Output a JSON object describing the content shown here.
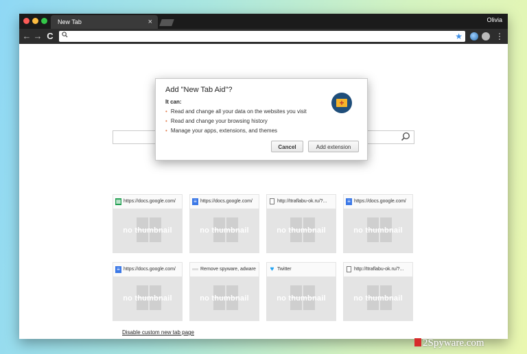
{
  "browser": {
    "tab_title": "New Tab",
    "tab_close": "×",
    "profile_name": "Olivia",
    "url": ""
  },
  "dialog": {
    "title": "Add \"New Tab Aid\"?",
    "it_can": "It can:",
    "permissions": [
      "Read and change all your data on the websites you visit",
      "Read and change your browsing history",
      "Manage your apps, extensions, and themes"
    ],
    "cancel_label": "Cancel",
    "add_label": "Add extension",
    "icon": "new-tab-aid-extension-icon"
  },
  "tiles": [
    {
      "url": "https://docs.google.com/",
      "favicon": "sheets-icon",
      "thumb": "no thumbnail"
    },
    {
      "url": "https://docs.google.com/",
      "favicon": "docs-icon",
      "thumb": "no thumbnail"
    },
    {
      "url": "http://ttraflabu-ok.ru/?...",
      "favicon": "page-icon",
      "thumb": "no thumbnail"
    },
    {
      "url": "https://docs.google.com/",
      "favicon": "docs-icon",
      "thumb": "no thumbnail"
    },
    {
      "url": "https://docs.google.com/",
      "favicon": "docs-icon",
      "thumb": "no thumbnail"
    },
    {
      "url": "Remove spyware, adware",
      "favicon": "site-icon",
      "thumb": "no thumbnail"
    },
    {
      "url": "Twitter",
      "favicon": "twitter-icon",
      "thumb": "no thumbnail"
    },
    {
      "url": "http://ttraflabu-ok.ru/?...",
      "favicon": "page-icon",
      "thumb": "no thumbnail"
    }
  ],
  "footer": {
    "disable_link": "Disable custom new tab page"
  },
  "watermark": "2Spyware.com",
  "colors": {
    "accent": "#3b8ee8",
    "titlebar": "#1b1b1b"
  }
}
